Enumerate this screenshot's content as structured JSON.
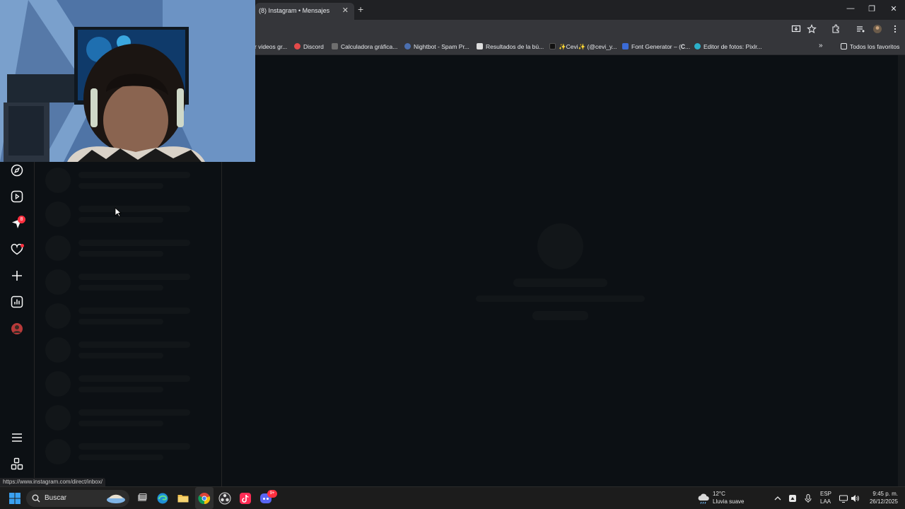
{
  "browser": {
    "tab_title": "(8) Instagram • Mensajes",
    "tab_close": "✕",
    "new_tab": "+",
    "window_controls": [
      "—",
      "❐",
      "✕"
    ],
    "bookmarks": [
      {
        "label": "r videos gr...",
        "color": "#4b7bd6"
      },
      {
        "label": "Discord",
        "color": "#e44a4a"
      },
      {
        "label": "Calculadora gráfica...",
        "color": "#8a8a8a"
      },
      {
        "label": "Nightbot - Spam Pr...",
        "color": "#4b6fb0"
      },
      {
        "label": "Resultados de la bú...",
        "color": "#dddddd"
      },
      {
        "label": "✨Cevi✨ (@cevi_y...",
        "color": "#111111"
      },
      {
        "label": "Font Generator – (𝐂...",
        "color": "#3b6bd6"
      },
      {
        "label": "Editor de fotos: Pixlr...",
        "color": "#2bb0c9"
      }
    ],
    "bookmarks_more": "»",
    "all_bookmarks": "Todos los favoritos",
    "status_url": "https://www.instagram.com/direct/inbox/"
  },
  "instagram": {
    "nav": [
      {
        "name": "explore-icon"
      },
      {
        "name": "reels-icon"
      },
      {
        "name": "messages-icon",
        "badge": "8"
      },
      {
        "name": "notifications-icon"
      },
      {
        "name": "create-icon"
      },
      {
        "name": "dashboard-icon"
      },
      {
        "name": "profile-avatar"
      },
      {
        "name": "more-menu-icon"
      },
      {
        "name": "threads-icon"
      }
    ],
    "skeleton_rows": 9
  },
  "taskbar": {
    "search_placeholder": "Buscar",
    "weather_temp": "12°C",
    "weather_desc": "Lluvia suave",
    "lang_top": "ESP",
    "lang_bottom": "LAA",
    "time": "9:45 p. m.",
    "date": "26/12/2025",
    "discord_badge": "9+"
  },
  "colors": {
    "page_bg": "#0c1014",
    "skeleton": "#121619",
    "badge": "#ff3040"
  }
}
